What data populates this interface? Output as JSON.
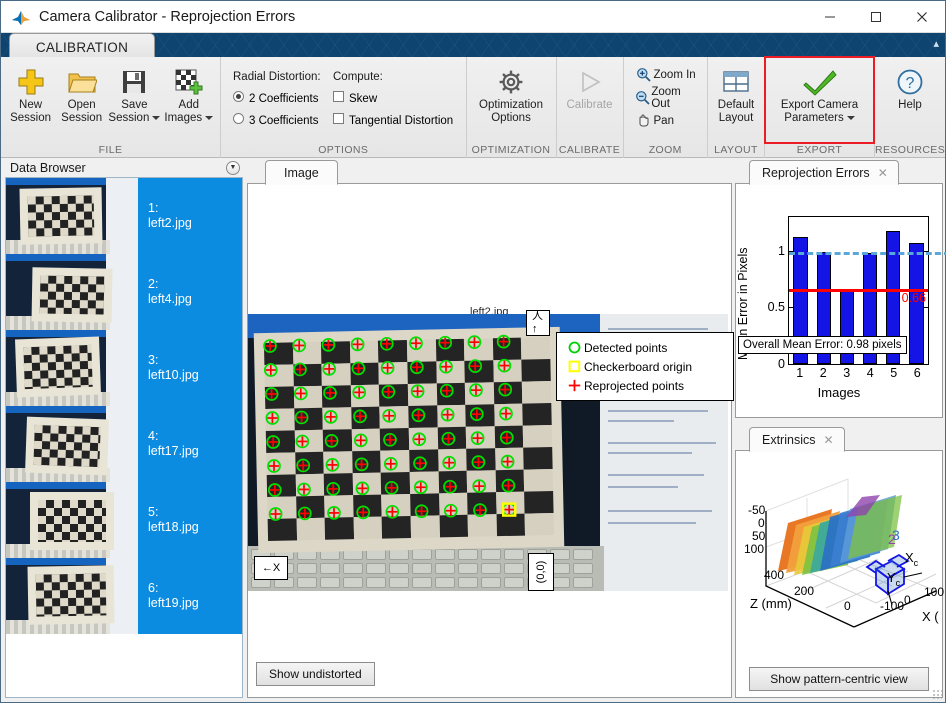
{
  "window": {
    "title": "Camera Calibrator - Reprojection Errors",
    "app_icon": "matlab-logo-icon",
    "minimize": "—",
    "maximize": "☐",
    "close": "✕"
  },
  "ribbon": {
    "tab": "CALIBRATION",
    "collapse": "▴",
    "groups": [
      {
        "name": "FILE",
        "buttons": [
          {
            "label_top": "New",
            "label_bottom": "Session",
            "icon": "plus-icon",
            "dropdown": false
          },
          {
            "label_top": "Open",
            "label_bottom": "Session",
            "icon": "folder-icon",
            "dropdown": false
          },
          {
            "label_top": "Save",
            "label_bottom": "Session",
            "icon": "floppy-disk-icon",
            "dropdown": true
          },
          {
            "label_top": "Add",
            "label_bottom": "Images",
            "icon": "checkerboard-add-icon",
            "dropdown": true
          }
        ]
      },
      {
        "name": "OPTIONS"
      },
      {
        "name": "OPTIMIZATION",
        "buttons": [
          {
            "label_top": "Optimization",
            "label_bottom": "Options",
            "icon": "gear-icon",
            "dropdown": false
          }
        ]
      },
      {
        "name": "CALIBRATE",
        "buttons": [
          {
            "label_top": "Calibrate",
            "label_bottom": "",
            "icon": "play-triangle-icon",
            "disabled": true
          }
        ]
      },
      {
        "name": "ZOOM"
      },
      {
        "name": "LAYOUT",
        "buttons": [
          {
            "label_top": "Default",
            "label_bottom": "Layout",
            "icon": "layout-grid-icon",
            "dropdown": false
          }
        ]
      },
      {
        "name": "EXPORT",
        "buttons": [
          {
            "label_top": "Export Camera",
            "label_bottom": "Parameters",
            "icon": "green-check-icon",
            "dropdown": true
          }
        ]
      },
      {
        "name": "RESOURCES",
        "buttons": [
          {
            "label_top": "Help",
            "label_bottom": "",
            "icon": "question-circle-icon",
            "dropdown": false
          }
        ]
      }
    ],
    "options": {
      "radial_label": "Radial Distortion:",
      "compute_label": "Compute:",
      "coef2": "2 Coefficients",
      "coef3": "3 Coefficients",
      "coef_selected": "2 Coefficients",
      "skew": "Skew",
      "skew_checked": false,
      "tangential": "Tangential Distortion",
      "tangential_checked": false
    },
    "zoom_items": [
      {
        "label": "Zoom In",
        "icon": "magnifier-plus-icon"
      },
      {
        "label": "Zoom Out",
        "icon": "magnifier-minus-icon"
      },
      {
        "label": "Pan",
        "icon": "hand-icon"
      }
    ],
    "export_highlight_color": "#ec1c24"
  },
  "data_browser": {
    "title": "Data Browser",
    "chevron": "▼",
    "selection_color": "#0c8ce0",
    "items": [
      {
        "index": "1:",
        "name": "left2.jpg"
      },
      {
        "index": "2:",
        "name": "left4.jpg"
      },
      {
        "index": "3:",
        "name": "left10.jpg"
      },
      {
        "index": "4:",
        "name": "left17.jpg"
      },
      {
        "index": "5:",
        "name": "left18.jpg"
      },
      {
        "index": "6:",
        "name": "left19.jpg"
      }
    ]
  },
  "image_panel": {
    "tab": "Image",
    "filename_overlay": "left2.jpg",
    "origin_overlay": "(0,0)",
    "x_axis_overlay": "←X",
    "y_axis_overlay": "人↑",
    "show_undistorted_button": "Show undistorted",
    "legend": [
      {
        "label": "Detected points",
        "marker": "circle-marker",
        "color": "#00d000"
      },
      {
        "label": "Checkerboard origin",
        "marker": "square-marker",
        "color": "#ffff00"
      },
      {
        "label": "Reprojected points",
        "marker": "plus-marker",
        "color": "#ff0000"
      }
    ]
  },
  "reprojection_panel": {
    "tab": "Reprojection Errors",
    "close_icon": "✕",
    "tooltip": "Overall Mean Error: 0.98 pixels"
  },
  "chart_data": {
    "type": "bar",
    "title": "",
    "categories": [
      "1",
      "2",
      "3",
      "4",
      "5",
      "6"
    ],
    "values": [
      1.12,
      0.99,
      0.66,
      0.98,
      1.18,
      1.07
    ],
    "xlabel": "Images",
    "ylabel": "Mean Error in Pixels",
    "ylim": [
      0,
      1.3
    ],
    "yticks": [
      0,
      0.5,
      1
    ],
    "ytick_labels": [
      "0",
      "0.5",
      "1"
    ],
    "bar_color": "#1414e6",
    "mean_line": {
      "value": 0.66,
      "label": "0.66",
      "color": "#ff0000"
    },
    "dashed_line": {
      "value": 0.99,
      "color": "#5aa8d8",
      "style": "dashed"
    },
    "overall_mean_error": "Overall Mean Error: 0.98 pixels",
    "grid": false,
    "legend": "none"
  },
  "extrinsics_panel": {
    "tab": "Extrinsics",
    "close_icon": "✕",
    "button": "Show pattern-centric view",
    "z_axis_label": "Z (mm)",
    "x_axis_label": "X (",
    "camera_label_x": "X",
    "camera_label_x_sub": "c",
    "camera_label_y": "Y",
    "camera_label_y_sub": "c",
    "y_ticks": [
      "-50",
      "0",
      "50",
      "100"
    ],
    "z_ticks": [
      "400",
      "200",
      "0"
    ],
    "x_ticks": [
      "-100",
      "0",
      "100"
    ],
    "board_indices": [
      "2",
      "3"
    ]
  }
}
